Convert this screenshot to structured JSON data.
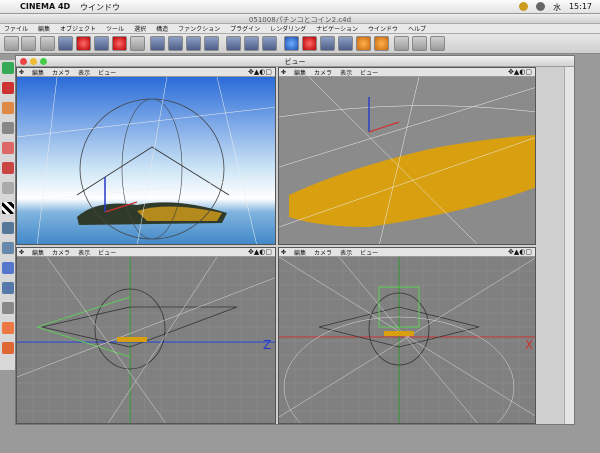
{
  "menubar": {
    "app": "CINEMA 4D",
    "window": "ウインドウ",
    "day": "水",
    "time": "15:17"
  },
  "title": "051008パチンコとコイン2.c4d",
  "menus": [
    "ファイル",
    "編集",
    "オブジェクト",
    "ツール",
    "選択",
    "構造",
    "ファンクション",
    "プラグイン",
    "レンダリング",
    "ナビゲーション",
    "ウインドウ",
    "ヘルプ"
  ],
  "view_window": {
    "title": "ビュー"
  },
  "viewports": [
    {
      "menu": [
        "編集",
        "カメラ",
        "表示",
        "ビュー"
      ],
      "icons": "✥▲◐▢"
    },
    {
      "menu": [
        "編集",
        "カメラ",
        "表示",
        "ビュー"
      ],
      "icons": "✥▲◐▢"
    },
    {
      "menu": [
        "編集",
        "カメラ",
        "表示",
        "ビュー"
      ],
      "icons": "✥▲◐▢"
    },
    {
      "menu": [
        "編集",
        "カメラ",
        "表示",
        "ビュー"
      ],
      "icons": "✥▲◐▢"
    }
  ],
  "axis_labels": {
    "side_z": "Z",
    "front_x": "X"
  },
  "colors": {
    "sky_top": "#2a6bd8",
    "ground_orange": "#d8a010",
    "grid_gray": "#7f7f7f"
  }
}
